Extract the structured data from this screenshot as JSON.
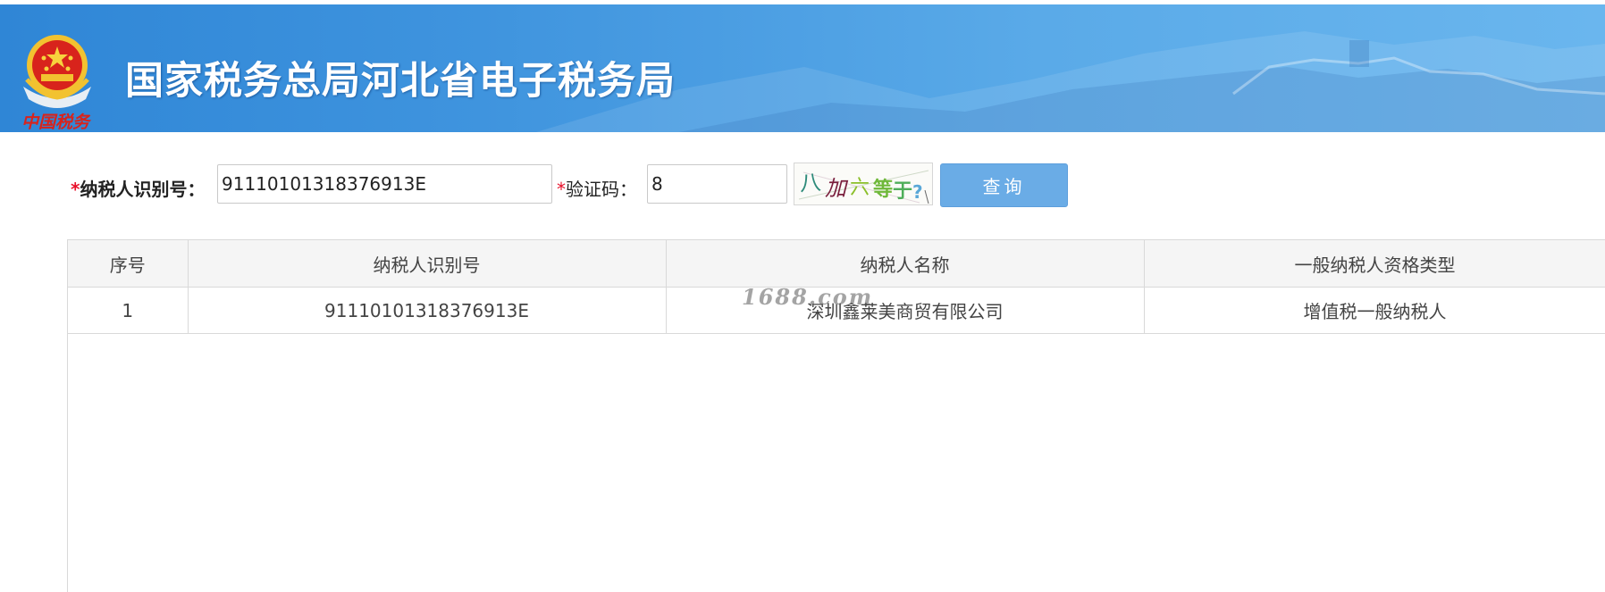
{
  "header": {
    "title": "国家税务总局河北省电子税务局",
    "logo_icon": "tax-emblem-icon",
    "logo_text": "中国税务",
    "colors": {
      "banner_start": "#2f86d6",
      "banner_end": "#6ab6ee",
      "title_text": "#ffffff"
    }
  },
  "search": {
    "taxid_required_mark": "*",
    "taxid_label": "纳税人识别号：",
    "taxid_value": "91110101318376913E",
    "captcha_required_mark": "*",
    "captcha_label": "验证码：",
    "captcha_value": "8",
    "captcha_image_chars": [
      "八",
      "加",
      "六",
      "等",
      "于",
      "?"
    ],
    "query_button_label": "查询",
    "colors": {
      "required": "#e8102a",
      "button_bg": "#6aace6"
    }
  },
  "results": {
    "columns": [
      "序号",
      "纳税人识别号",
      "纳税人名称",
      "一般纳税人资格类型"
    ],
    "rows": [
      {
        "index": "1",
        "taxid": "91110101318376913E",
        "name": "深圳鑫莱美商贸有限公司",
        "qualification": "增值税一般纳税人"
      }
    ]
  },
  "watermark": "1688.com"
}
